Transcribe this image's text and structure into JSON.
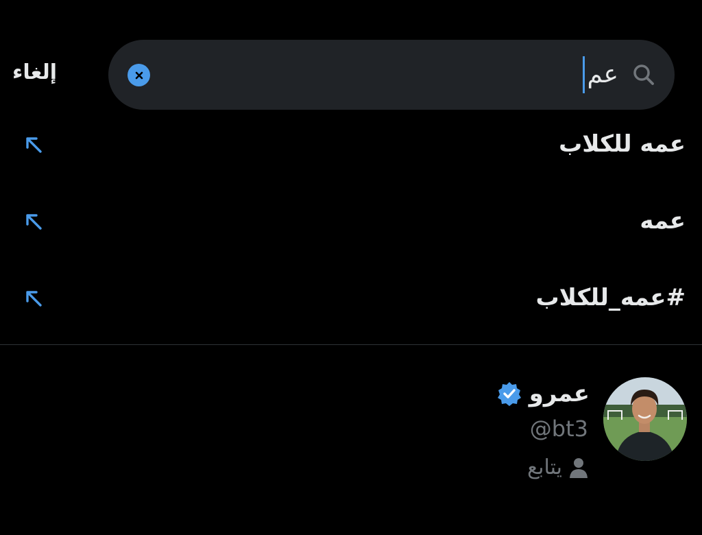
{
  "header": {
    "cancel_label": "إلغاء"
  },
  "search": {
    "value": "عم",
    "icon": "search-icon",
    "clear_icon": "clear-icon"
  },
  "suggestions": [
    {
      "label": "عمه للكلاب",
      "icon": "arrow-up-left-icon"
    },
    {
      "label": "عمه",
      "icon": "arrow-up-left-icon"
    },
    {
      "label": "#عمه_للكلاب",
      "icon": "arrow-up-left-icon"
    }
  ],
  "user_result": {
    "name": "عمرو",
    "verified": true,
    "handle": "@bt3",
    "follows_label": "يتابع"
  },
  "colors": {
    "background": "#000000",
    "search_bg": "#202327",
    "accent": "#4a9bea",
    "text_primary": "#e7e9ea",
    "text_secondary": "#71767b"
  }
}
